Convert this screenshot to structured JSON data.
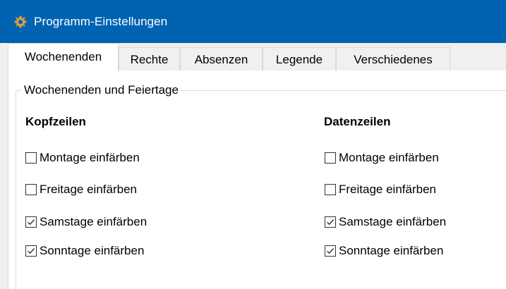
{
  "window": {
    "title": "Programm-Einstellungen",
    "icon": "gear-icon",
    "titlebar_color": "#0063b1"
  },
  "tabs": [
    {
      "label": "Wochenenden",
      "active": true
    },
    {
      "label": "Rechte",
      "active": false
    },
    {
      "label": "Absenzen",
      "active": false
    },
    {
      "label": "Legende",
      "active": false
    },
    {
      "label": "Verschiedenes",
      "active": false
    }
  ],
  "group": {
    "legend": "Wochenenden und Feiertage",
    "header_column": {
      "title": "Kopfzeilen",
      "options": [
        {
          "label": "Montage einfärben",
          "checked": false
        },
        {
          "label": "Freitage einfärben",
          "checked": false
        },
        {
          "label": "Samstage einfärben",
          "checked": true
        },
        {
          "label": "Sonntage einfärben",
          "checked": true
        }
      ]
    },
    "data_column": {
      "title": "Datenzeilen",
      "options": [
        {
          "label": "Montage einfärben",
          "checked": false
        },
        {
          "label": "Freitage einfärben",
          "checked": false
        },
        {
          "label": "Samstage einfärben",
          "checked": true
        },
        {
          "label": "Sonntage einfärben",
          "checked": true
        }
      ]
    }
  }
}
